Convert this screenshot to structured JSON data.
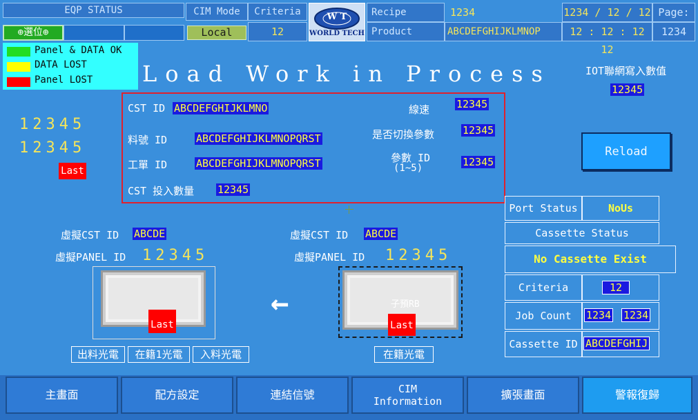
{
  "header": {
    "eqp_status": "EQP STATUS",
    "status_btn": "⊕選位⊕",
    "cim_mode_label": "CIM Mode",
    "cim_mode_value": "Local",
    "criteria_label": "Criteria",
    "criteria_value": "12",
    "logo_top": "W T",
    "logo_bottom": "WORLD TECH",
    "recipe_label": "Recipe",
    "recipe_value": "1234",
    "product_label": "Product",
    "product_value": "ABCDEFGHIJKLMNOP",
    "date": "1234 / 12 / 12",
    "time": "12 : 12 : 12  12",
    "page_label": "Page:",
    "page_value": "1234"
  },
  "legend": [
    {
      "label": "Panel & DATA OK",
      "color": "#22dd22"
    },
    {
      "label": "DATA LOST",
      "color": "#ffff00"
    },
    {
      "label": "Panel LOST",
      "color": "#ff0000"
    }
  ],
  "title": "Load Work in Process",
  "iot": {
    "label": "IOT聯網寫入數值",
    "value": "12345"
  },
  "left_counters": {
    "value1": "12345",
    "value2": "12345",
    "last": "Last"
  },
  "info": {
    "cst_id_label": "CST ID",
    "cst_id_value": "ABCDEFGHIJKLMNO",
    "material_label": "料號 ID",
    "material_value": "ABCDEFGHIJKLMNOPQRST",
    "work_order_label": "工單 ID",
    "work_order_value": "ABCDEFGHIJKLMNOPQRST",
    "cst_qty_label": "CST 投入數量",
    "cst_qty_value": "12345",
    "line_speed_label": "線速",
    "line_speed_value": "12345",
    "switch_param_label": "是否切換參數",
    "switch_param_value": "12345",
    "param_id_label": "參數 ID",
    "param_id_range": "(1~5)",
    "param_id_value": "12345"
  },
  "reload_label": "Reload",
  "port": {
    "port_status_label": "Port Status",
    "port_status_value": "NoUs",
    "cassette_status_label": "Cassette Status",
    "cassette_status_value": "No Cassette Exist",
    "criteria_label": "Criteria",
    "criteria_value": "12",
    "job_count_label": "Job Count",
    "job_count_value1": "1234",
    "job_count_value2": "1234",
    "cassette_id_label": "Cassette ID",
    "cassette_id_value": "ABCDEFGHIJ"
  },
  "left_station": {
    "virt_cst_label": "虛擬CST ID",
    "virt_cst_value": "ABCDE",
    "virt_panel_label": "虛擬PANEL ID",
    "virt_panel_value": "12345",
    "last": "Last",
    "sensors": [
      "出料光電",
      "在籍1光電",
      "入料光電"
    ]
  },
  "right_station": {
    "virt_cst_label": "虛擬CST ID",
    "virt_cst_value": "ABCDE",
    "virt_panel_label": "虛擬PANEL ID",
    "virt_panel_value": "12345",
    "tray_text": "子預RB",
    "last": "Last",
    "sensors": [
      "在籍光電"
    ]
  },
  "arrow": "←",
  "bottom_nav": [
    "主畫面",
    "配方設定",
    "連結信號",
    "CIM\nInformation",
    "擴張畫面",
    "警報復歸"
  ],
  "colors": {
    "background": "#3a8fdc",
    "value_bg": "#1a1ae0",
    "value_fg": "#ffff40",
    "alert_red": "#ff0000",
    "info_border": "#e0202c"
  }
}
